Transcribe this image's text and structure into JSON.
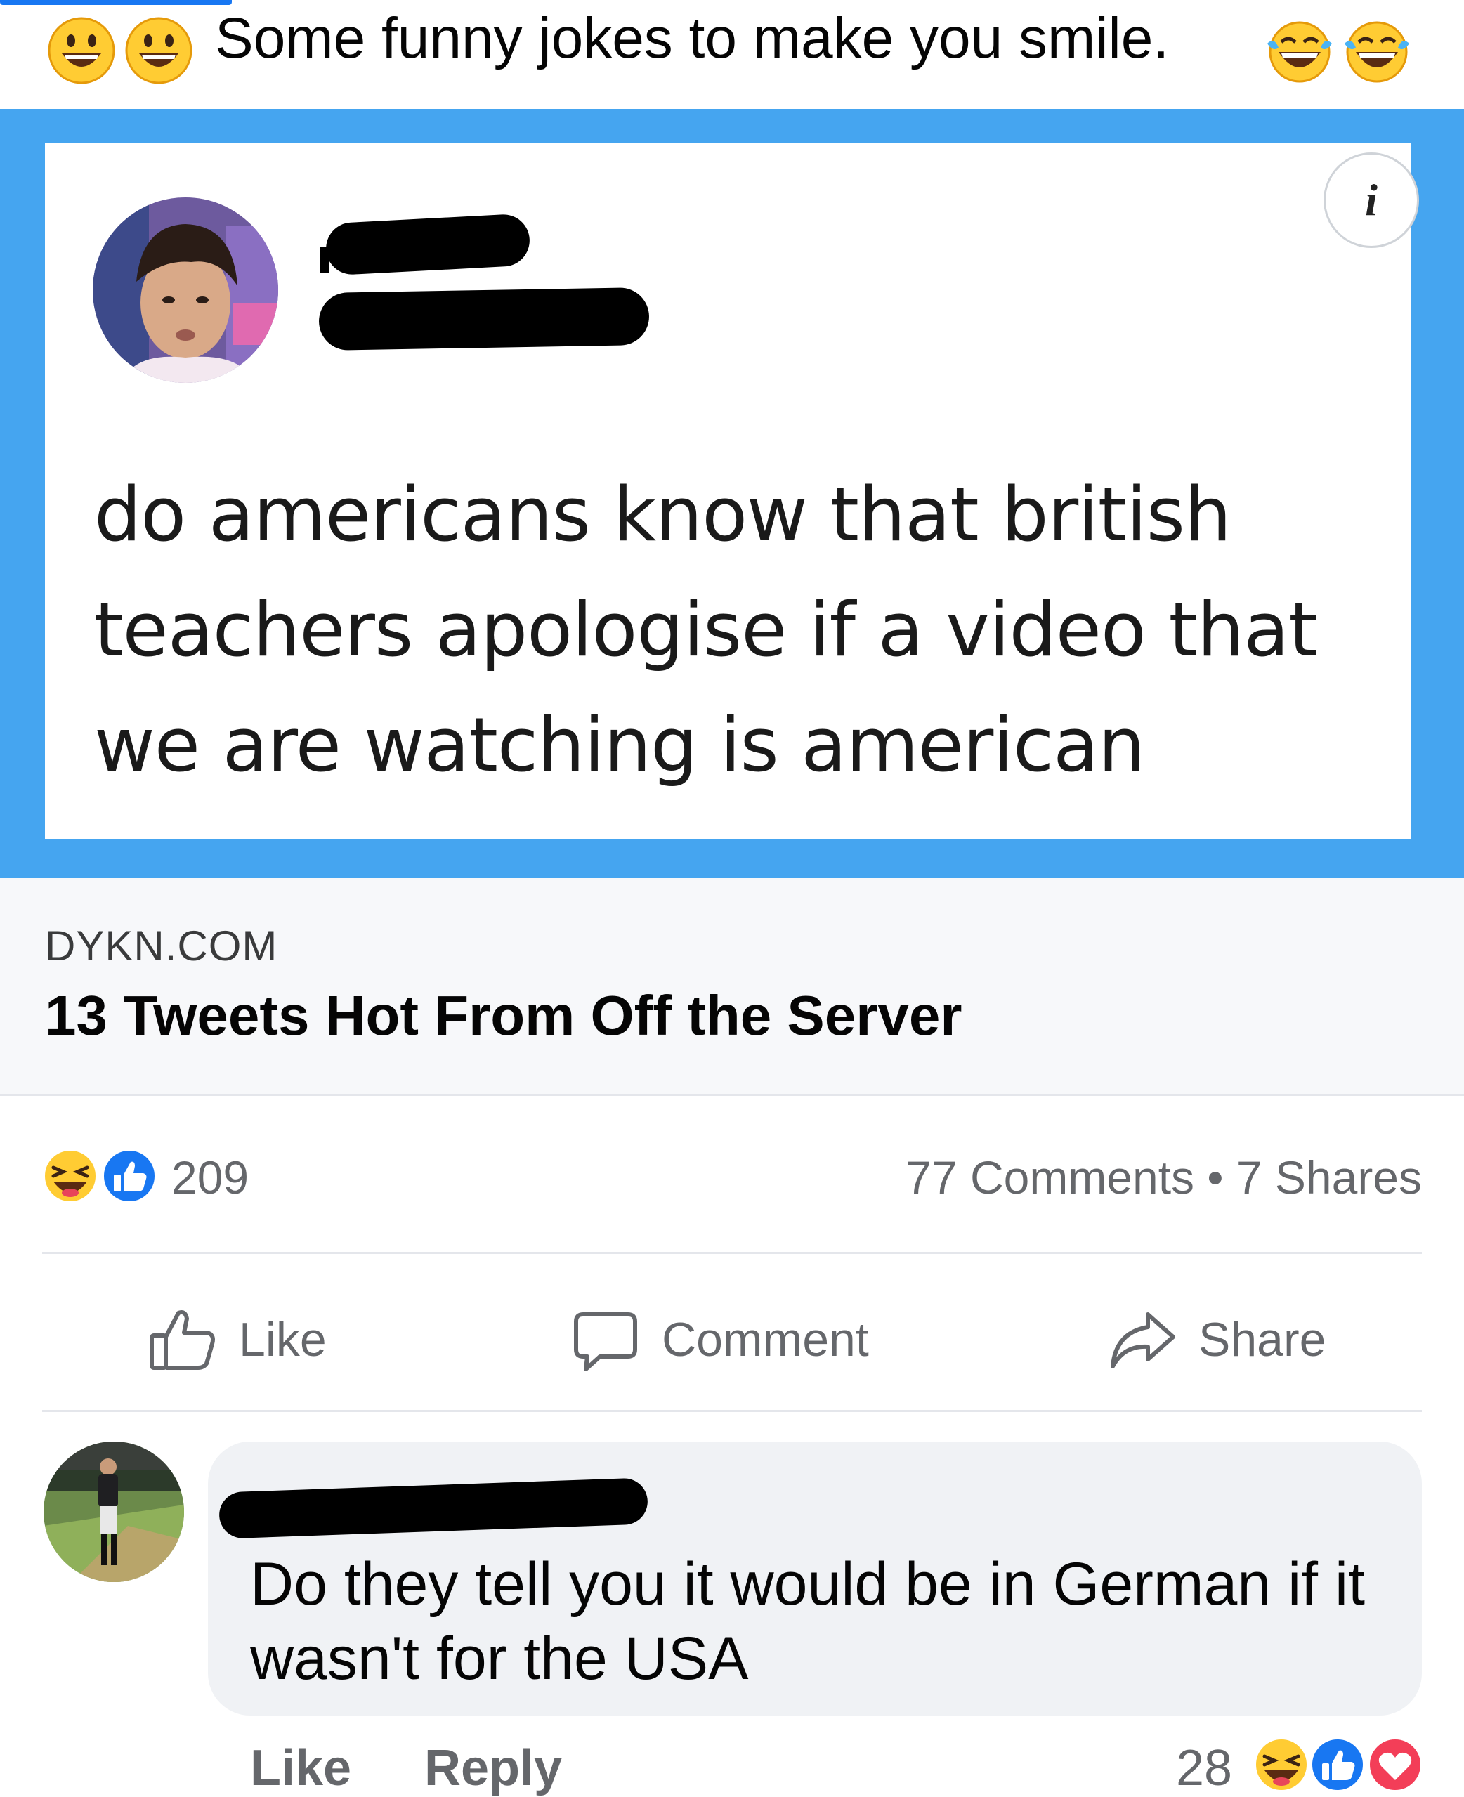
{
  "post": {
    "caption": "Some funny jokes to make you smile.",
    "caption_emojis_left": [
      "grinning-face",
      "grinning-face"
    ],
    "caption_emojis_right": [
      "face-with-tears-of-joy",
      "face-with-tears-of-joy"
    ]
  },
  "tweet": {
    "text": "do americans know that british teachers apologise if a video that we are watching is american",
    "info_label": "i"
  },
  "link_preview": {
    "domain": "DYKN.COM",
    "title": "13 Tweets Hot From Off the Server"
  },
  "stats": {
    "reaction_count": "209",
    "reaction_icons": [
      "haha",
      "like"
    ],
    "comments_shares": "77 Comments • 7 Shares"
  },
  "actions": {
    "like": "Like",
    "comment": "Comment",
    "share": "Share"
  },
  "comment": {
    "text": "Do they tell you it would be in German if it wasn't for the USA",
    "like": "Like",
    "reply": "Reply",
    "reaction_count": "28",
    "reaction_icons": [
      "haha",
      "like",
      "love"
    ]
  },
  "colors": {
    "accent": "#1877f2",
    "tweet_frame": "#45a5f0",
    "secondary_text": "#65676b",
    "bubble": "#f0f2f5"
  }
}
